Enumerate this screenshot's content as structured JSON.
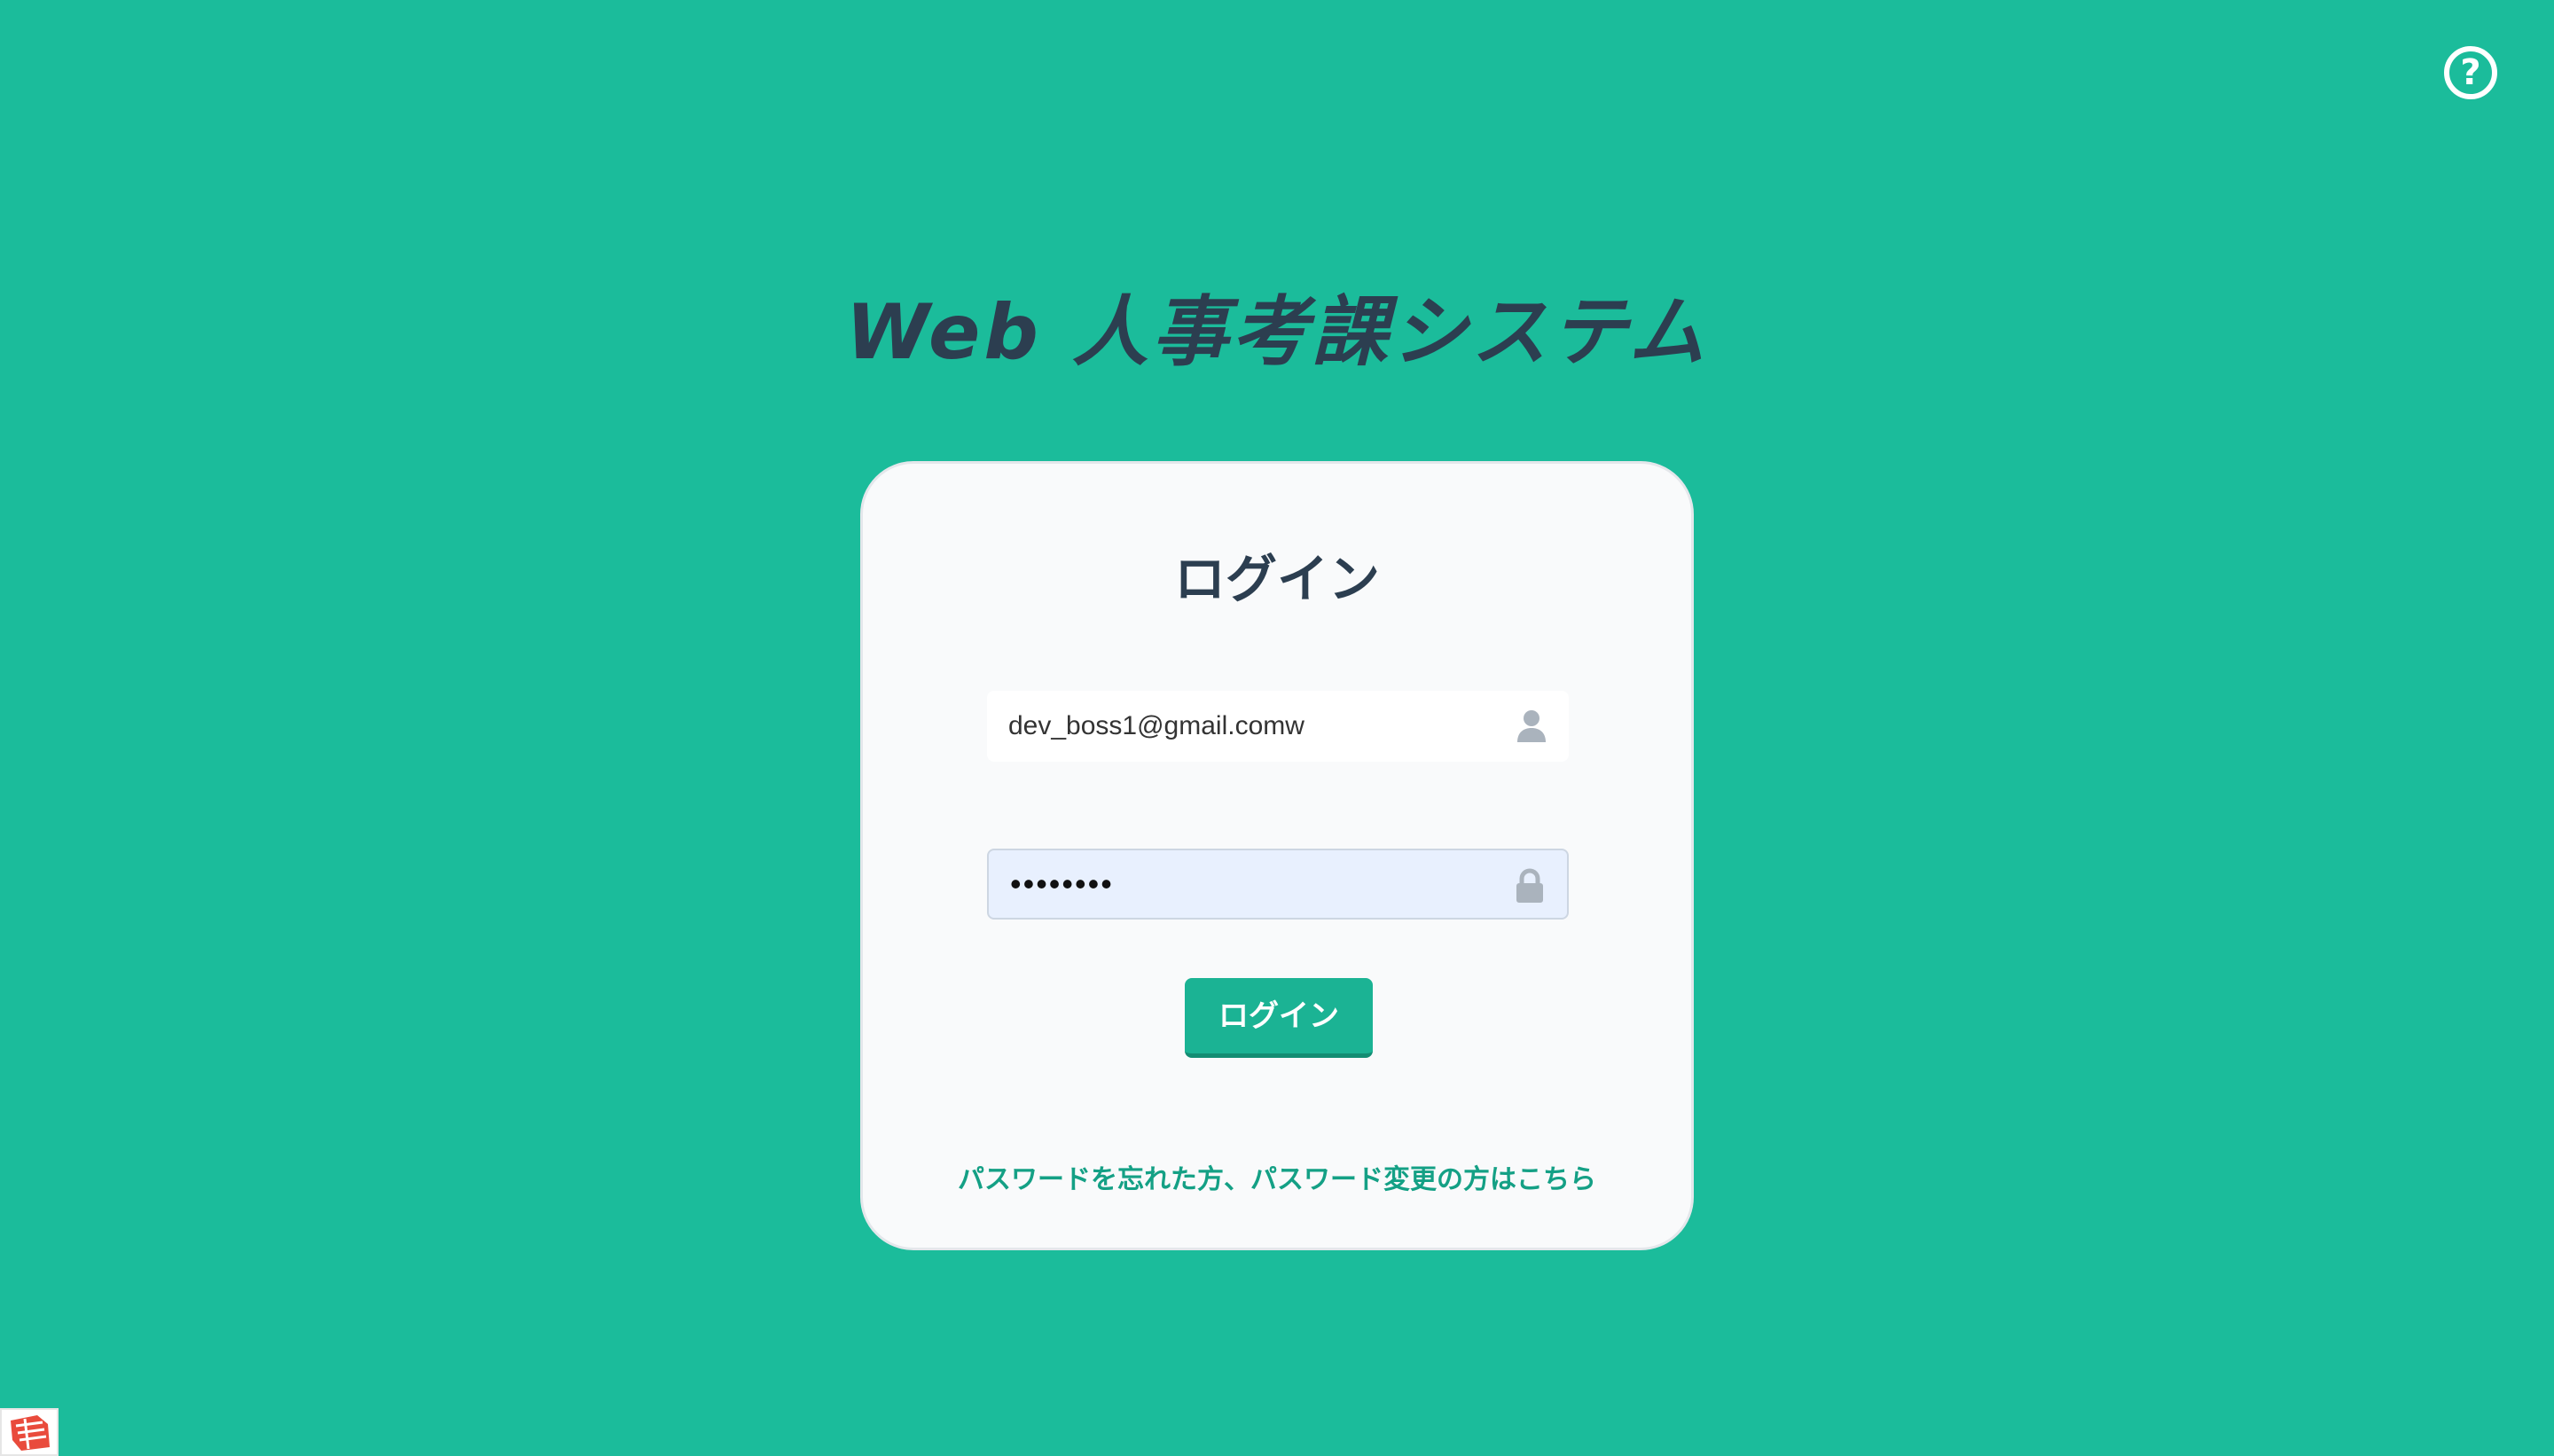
{
  "app": {
    "title": "Web 人事考課システム"
  },
  "help": {
    "label": "?",
    "icon": "question-circle-icon"
  },
  "login_card": {
    "title": "ログイン",
    "email": {
      "value": "dev_boss1@gmail.comw",
      "icon": "user-icon"
    },
    "password": {
      "value": "••••••••",
      "icon": "lock-icon"
    },
    "submit_label": "ログイン",
    "forgot_link": "パスワードを忘れた方、パスワード変更の方はこちら"
  },
  "corner_badge": {
    "icon": "extension-icon"
  },
  "colors": {
    "background": "#1bbc9b",
    "title_text": "#2c3e50",
    "card_bg": "#f9fafb",
    "button": "#1bb394",
    "link": "#14a085",
    "icon_gray": "#aab3bd"
  }
}
